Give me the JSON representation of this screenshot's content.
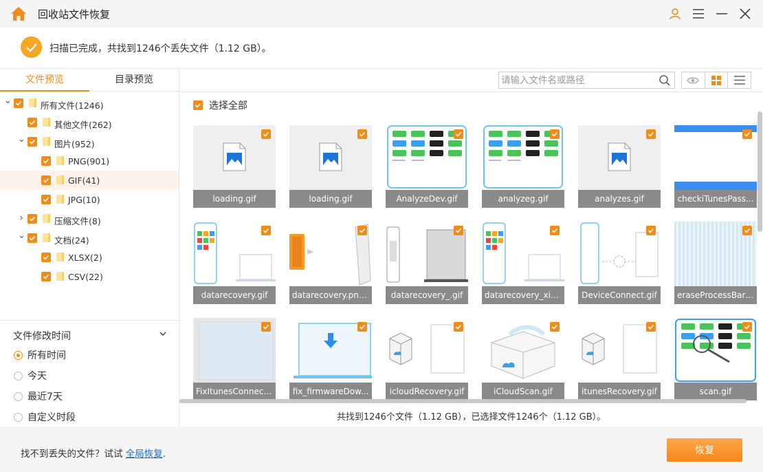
{
  "app": {
    "title": "回收站文件恢复",
    "accent": "#f08c1a"
  },
  "status": {
    "message": "扫描已完成，共找到1246个丢失文件（1.12 GB）。"
  },
  "tabs": [
    {
      "label": "文件预览",
      "active": true
    },
    {
      "label": "目录预览",
      "active": false
    }
  ],
  "tree": [
    {
      "label": "所有文件(1246)",
      "level": 0,
      "expanded": true,
      "has_children": true
    },
    {
      "label": "其他文件(262)",
      "level": 1,
      "expanded": false,
      "has_children": false
    },
    {
      "label": "图片(952)",
      "level": 1,
      "expanded": true,
      "has_children": true
    },
    {
      "label": "PNG(901)",
      "level": 2,
      "expanded": false,
      "has_children": false
    },
    {
      "label": "GIF(41)",
      "level": 2,
      "expanded": false,
      "has_children": false,
      "selected": true
    },
    {
      "label": "JPG(10)",
      "level": 2,
      "expanded": false,
      "has_children": false
    },
    {
      "label": "压缩文件(8)",
      "level": 1,
      "expanded": false,
      "has_children": true
    },
    {
      "label": "文档(24)",
      "level": 1,
      "expanded": true,
      "has_children": true
    },
    {
      "label": "XLSX(2)",
      "level": 2,
      "expanded": false,
      "has_children": false
    },
    {
      "label": "CSV(22)",
      "level": 2,
      "expanded": false,
      "has_children": false
    }
  ],
  "filter": {
    "title": "文件修改时间",
    "options": [
      {
        "label": "所有时间",
        "checked": true
      },
      {
        "label": "今天",
        "checked": false
      },
      {
        "label": "最近7天",
        "checked": false
      },
      {
        "label": "自定义时段",
        "checked": false
      }
    ]
  },
  "search": {
    "placeholder": "请输入文件名或路径"
  },
  "select_all": {
    "label": "选择全部"
  },
  "files": [
    {
      "name": "loading.gif",
      "thumb": "doc-icon"
    },
    {
      "name": "loading.gif",
      "thumb": "doc-icon"
    },
    {
      "name": "AnalyzeDev.gif",
      "thumb": "tablet-apps"
    },
    {
      "name": "analyzeg.gif",
      "thumb": "tablet-apps"
    },
    {
      "name": "analyzes.gif",
      "thumb": "doc-icon"
    },
    {
      "name": "checkiTunesPass...",
      "thumb": "blue-bars"
    },
    {
      "name": "datarecovery.gif",
      "thumb": "phone-laptop"
    },
    {
      "name": "datarecovery.png...",
      "thumb": "door-phone"
    },
    {
      "name": "datarecovery_.gif",
      "thumb": "phone-tablet"
    },
    {
      "name": "datarecovery_xiao...",
      "thumb": "phone-laptop"
    },
    {
      "name": "DeviceConnect.gif",
      "thumb": "device-connect"
    },
    {
      "name": "eraseProcessBar_...",
      "thumb": "stripes"
    },
    {
      "name": "FixItunesConnect....",
      "thumb": "window"
    },
    {
      "name": "fix_firmwareDow...",
      "thumb": "laptop-download"
    },
    {
      "name": "icloudRecovery.gif",
      "thumb": "box-tablet"
    },
    {
      "name": "iCloudScan.gif",
      "thumb": "cloud-box"
    },
    {
      "name": "itunesRecovery.gif",
      "thumb": "box-tablet"
    },
    {
      "name": "scan.gif",
      "thumb": "scan-tablet"
    }
  ],
  "summary": "共找到1246个文件（1.12 GB），已选择文件1246个（1.12 GB）。",
  "bottom": {
    "hint_prefix": "找不到丢失的文件？试试",
    "hint_link": "全局恢复",
    "hint_suffix": ".",
    "recover_label": "恢复"
  }
}
